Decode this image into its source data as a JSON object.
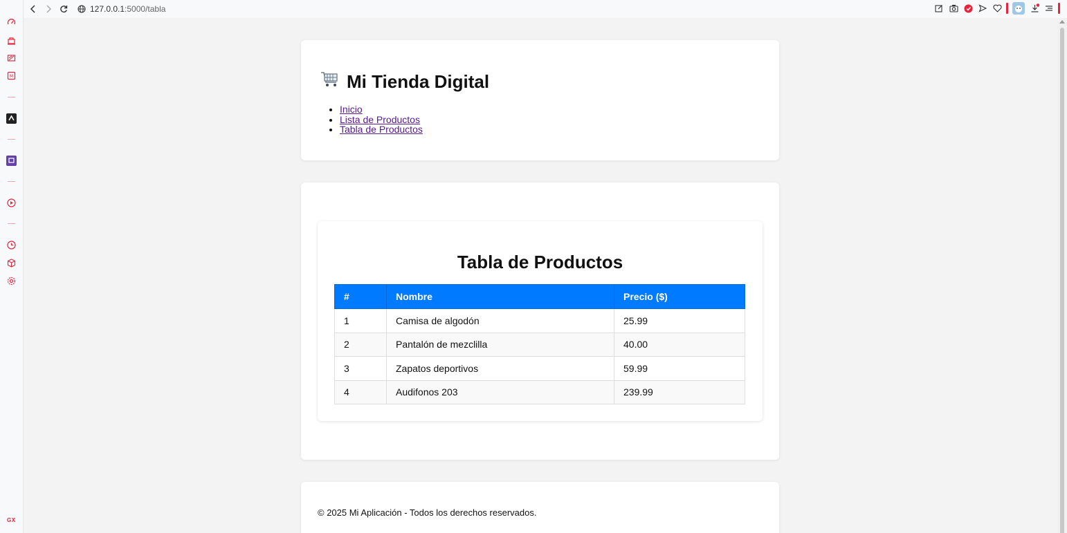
{
  "browser": {
    "url_host": "127.0.0.1",
    "url_path": ":5000/tabla"
  },
  "colors": {
    "accent": "#007bff",
    "brand_red": "#e8243c",
    "link_visited": "#551a8b"
  },
  "header": {
    "title": "Mi Tienda Digital",
    "title_icon": "shopping-cart-icon",
    "nav": [
      {
        "label": "Inicio"
      },
      {
        "label": "Lista de Productos"
      },
      {
        "label": "Tabla de Productos"
      }
    ]
  },
  "main": {
    "heading": "Tabla de Productos",
    "table": {
      "columns": [
        "#",
        "Nombre",
        "Precio ($)"
      ],
      "rows": [
        {
          "id": "1",
          "name": "Camisa de algodón",
          "price": "25.99"
        },
        {
          "id": "2",
          "name": "Pantalón de mezclilla",
          "price": "40.00"
        },
        {
          "id": "3",
          "name": "Zapatos deportivos",
          "price": "59.99"
        },
        {
          "id": "4",
          "name": "Audifonos 203",
          "price": "239.99"
        }
      ]
    }
  },
  "footer": {
    "text": "© 2025 Mi Aplicación - Todos los derechos reservados."
  },
  "sidebar_logo": "GX"
}
